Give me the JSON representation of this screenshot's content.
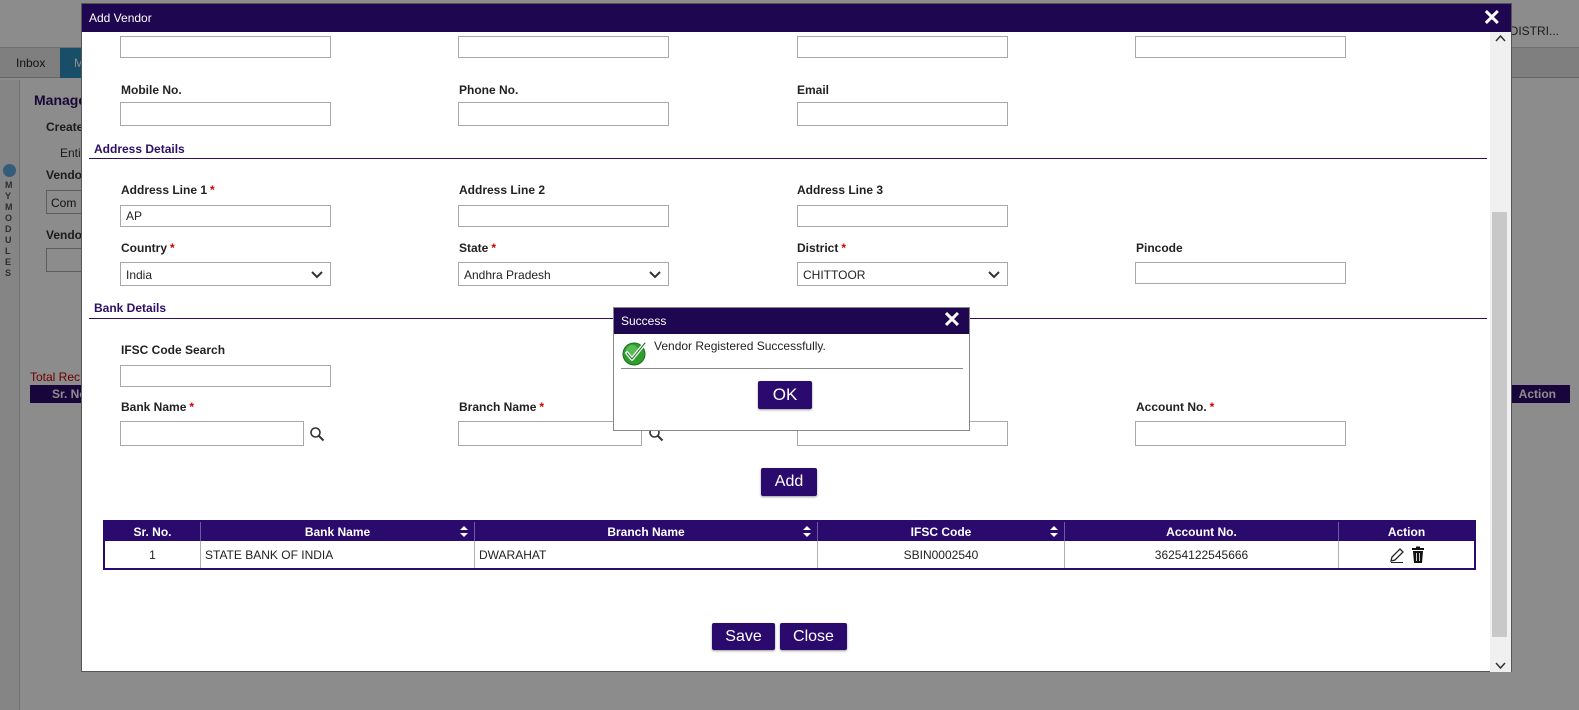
{
  "background": {
    "header_text": "DISTRI...",
    "tabs": [
      "Inbox",
      "M"
    ],
    "side_letters": "MY MODULES",
    "page_title": "Manage",
    "labels": [
      "Create",
      "Enti",
      "Vendo",
      "Vendo"
    ],
    "combo_value": "Com",
    "total_label": "Total Rec",
    "table_first_header": "Sr. No",
    "table_last_header": "Action"
  },
  "dialog": {
    "title": "Add Vendor",
    "close_glyph": "✕",
    "contact": {
      "mobile_label": "Mobile No.",
      "phone_label": "Phone No.",
      "email_label": "Email"
    },
    "address": {
      "section_title": "Address Details",
      "line1_label": "Address Line 1",
      "line1_value": "AP",
      "line2_label": "Address Line 2",
      "line3_label": "Address Line 3",
      "country_label": "Country",
      "country_value": "India",
      "state_label": "State",
      "state_value": "Andhra Pradesh",
      "district_label": "District",
      "district_value": "CHITTOOR",
      "pincode_label": "Pincode",
      "required_mark": "*"
    },
    "bank": {
      "section_title": "Bank Details",
      "ifsc_search_label": "IFSC Code Search",
      "bank_name_label": "Bank Name",
      "branch_name_label": "Branch Name",
      "account_no_label": "Account No.",
      "add_button": "Add"
    },
    "grid": {
      "headers": [
        "Sr. No.",
        "Bank Name",
        "Branch Name",
        "IFSC Code",
        "Account No.",
        "Action"
      ],
      "rows": [
        {
          "sr": "1",
          "bank": "STATE BANK OF INDIA",
          "branch": "DWARAHAT",
          "ifsc": "SBIN0002540",
          "account": "36254122545666"
        }
      ]
    },
    "save_button": "Save",
    "close_button": "Close"
  },
  "popup": {
    "title": "Success",
    "message": "Vendor Registered Successfully.",
    "ok_button": "OK",
    "close_glyph": "✕"
  },
  "colors": {
    "primary": "#2b0a6e",
    "titlebar": "#1e0650",
    "required": "#d00000"
  }
}
